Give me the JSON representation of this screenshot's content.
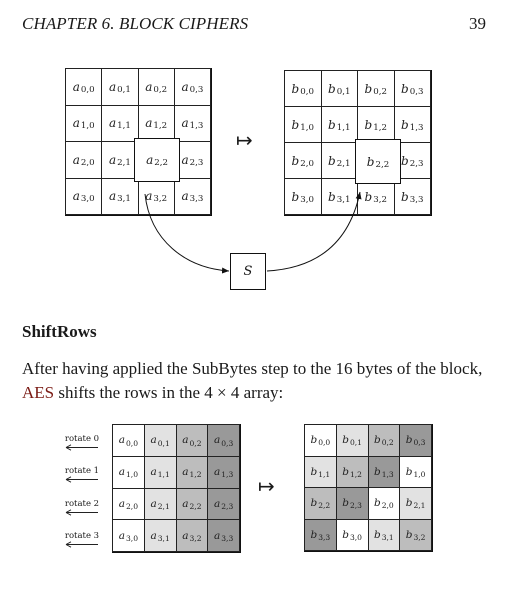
{
  "header": {
    "chapter_title": "CHAPTER 6.  BLOCK CIPHERS",
    "page_number": "39"
  },
  "figure_subbytes": {
    "input_var": "a",
    "output_var": "b",
    "mapsto_symbol": "↦",
    "sbox_label": "S",
    "highlighted_cell": "2,2",
    "input_cells": [
      [
        "0,0",
        "0,1",
        "0,2",
        "0,3"
      ],
      [
        "1,0",
        "1,1",
        "1,2",
        "1,3"
      ],
      [
        "2,0",
        "2,1",
        "2,2",
        "2,3"
      ],
      [
        "3,0",
        "3,1",
        "3,2",
        "3,3"
      ]
    ],
    "output_cells": [
      [
        "0,0",
        "0,1",
        "0,2",
        "0,3"
      ],
      [
        "1,0",
        "1,1",
        "1,2",
        "1,3"
      ],
      [
        "2,0",
        "2,1",
        "2,2",
        "2,3"
      ],
      [
        "3,0",
        "3,1",
        "3,2",
        "3,3"
      ]
    ]
  },
  "section": {
    "title": "ShiftRows",
    "paragraph_pre": "After having applied the SubBytes step to the 16 bytes of the block, ",
    "paragraph_link": "AES",
    "paragraph_post": " shifts the rows in the 4 × 4 array:"
  },
  "figure_shiftrows": {
    "mapsto_symbol": "↦",
    "rotate_labels": [
      "rotate 0",
      "rotate 1",
      "rotate 2",
      "rotate 3"
    ],
    "shade_colors": [
      "#ffffff",
      "#e2e2e2",
      "#bdbdbd",
      "#999999"
    ],
    "input_var": "a",
    "output_var": "b",
    "input_cells": [
      [
        {
          "sub": "0,0",
          "shade": 0
        },
        {
          "sub": "0,1",
          "shade": 1
        },
        {
          "sub": "0,2",
          "shade": 2
        },
        {
          "sub": "0,3",
          "shade": 3
        }
      ],
      [
        {
          "sub": "1,0",
          "shade": 0
        },
        {
          "sub": "1,1",
          "shade": 1
        },
        {
          "sub": "1,2",
          "shade": 2
        },
        {
          "sub": "1,3",
          "shade": 3
        }
      ],
      [
        {
          "sub": "2,0",
          "shade": 0
        },
        {
          "sub": "2,1",
          "shade": 1
        },
        {
          "sub": "2,2",
          "shade": 2
        },
        {
          "sub": "2,3",
          "shade": 3
        }
      ],
      [
        {
          "sub": "3,0",
          "shade": 0
        },
        {
          "sub": "3,1",
          "shade": 1
        },
        {
          "sub": "3,2",
          "shade": 2
        },
        {
          "sub": "3,3",
          "shade": 3
        }
      ]
    ],
    "output_cells": [
      [
        {
          "sub": "0,0",
          "shade": 0
        },
        {
          "sub": "0,1",
          "shade": 1
        },
        {
          "sub": "0,2",
          "shade": 2
        },
        {
          "sub": "0,3",
          "shade": 3
        }
      ],
      [
        {
          "sub": "1,1",
          "shade": 1
        },
        {
          "sub": "1,2",
          "shade": 2
        },
        {
          "sub": "1,3",
          "shade": 3
        },
        {
          "sub": "1,0",
          "shade": 0
        }
      ],
      [
        {
          "sub": "2,2",
          "shade": 2
        },
        {
          "sub": "2,3",
          "shade": 3
        },
        {
          "sub": "2,0",
          "shade": 0
        },
        {
          "sub": "2,1",
          "shade": 1
        }
      ],
      [
        {
          "sub": "3,3",
          "shade": 3
        },
        {
          "sub": "3,0",
          "shade": 0
        },
        {
          "sub": "3,1",
          "shade": 1
        },
        {
          "sub": "3,2",
          "shade": 2
        }
      ]
    ]
  }
}
